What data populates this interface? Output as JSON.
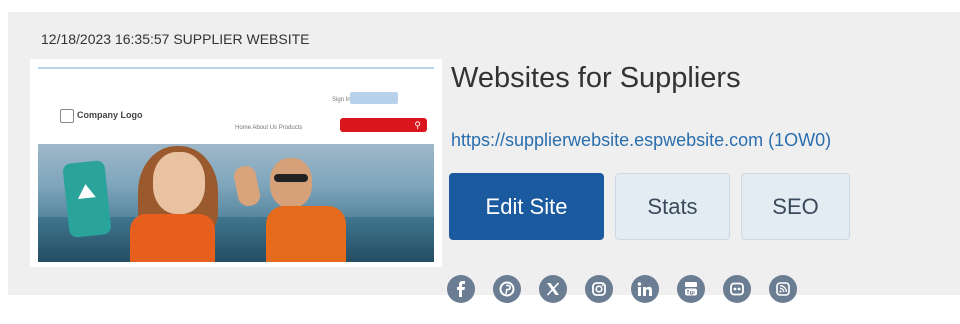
{
  "card": {
    "timestamp_label": "12/18/2023 16:35:57 SUPPLIER WEBSITE",
    "thumbnail": {
      "logo_text": "Company Logo",
      "signin_text": "Sign In",
      "nav_text": "Home   About Us   Products"
    },
    "site_title": "Websites for Suppliers",
    "site_url": "https://supplierwebsite.espwebsite.com (1OW0)",
    "buttons": {
      "edit": "Edit Site",
      "stats": "Stats",
      "seo": "SEO"
    },
    "social_icons": [
      {
        "name": "facebook-icon",
        "glyph": "f"
      },
      {
        "name": "pinterest-icon",
        "glyph": "p"
      },
      {
        "name": "x-twitter-icon",
        "glyph": "X"
      },
      {
        "name": "instagram-icon",
        "glyph": "ig"
      },
      {
        "name": "linkedin-icon",
        "glyph": "in"
      },
      {
        "name": "youtube-icon",
        "glyph": "yt"
      },
      {
        "name": "flickr-icon",
        "glyph": "••"
      },
      {
        "name": "rss-icon",
        "glyph": "rss"
      }
    ]
  },
  "colors": {
    "primary_button": "#1c5a9f",
    "secondary_button": "#e3ebf3",
    "link": "#2a6ead",
    "social_icon": "#6b7d92",
    "card_background": "#efefef"
  }
}
